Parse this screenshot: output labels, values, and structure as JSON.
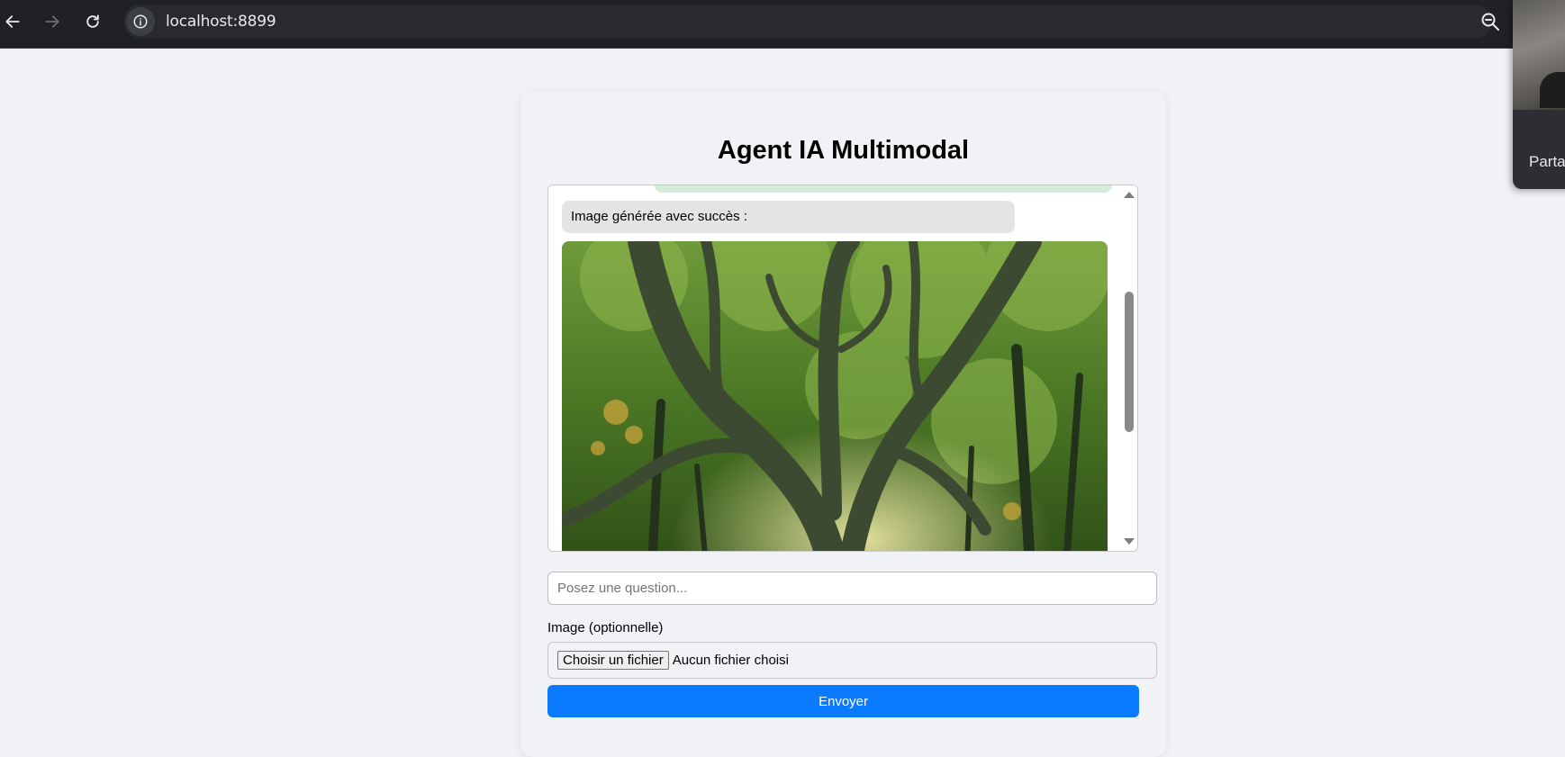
{
  "browser": {
    "url": "localhost:8899",
    "icons": {
      "back": "arrow-left-icon",
      "forward": "arrow-right-icon",
      "reload": "reload-icon",
      "site_info": "info-icon",
      "zoom": "zoom-out-icon"
    }
  },
  "share_popup": {
    "label": "Parta"
  },
  "app": {
    "title": "Agent IA Multimodal",
    "chat": {
      "bot_message": "Image générée avec succès :",
      "image_subject": "forest-tree-image"
    },
    "question_input": {
      "placeholder": "Posez une question...",
      "value": ""
    },
    "image_label": "Image (optionnelle)",
    "file_input": {
      "button_label": "Choisir un fichier",
      "status": "Aucun fichier choisi"
    },
    "send_button": "Envoyer"
  },
  "colors": {
    "page_bg": "#f0f2f5",
    "accent": "#0a7bff",
    "bot_bubble": "#e3e4e6",
    "user_bubble": "#d4ebdc",
    "browser_bar": "#202124"
  }
}
